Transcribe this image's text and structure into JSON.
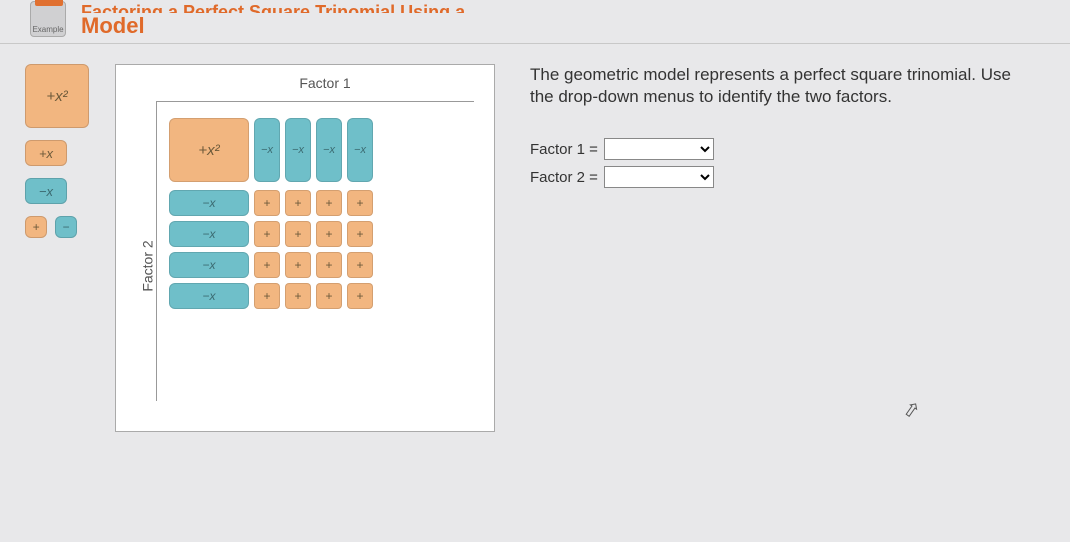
{
  "header": {
    "badge_label": "Example",
    "title_top": "Factoring a Perfect Square Trinomial Using a",
    "title_bottom": "Model"
  },
  "palette": {
    "x2": "+x²",
    "plus_x": "+x",
    "minus_x": "−x",
    "plus_unit": "+",
    "minus_unit": "−"
  },
  "board": {
    "factor1_label": "Factor 1",
    "factor2_label": "Factor 2",
    "big_x2": "+x²",
    "col_tiles": [
      "−x",
      "−x",
      "−x",
      "−x"
    ],
    "rows": [
      {
        "side": "−x",
        "units": [
          "+",
          "+",
          "+",
          "+"
        ]
      },
      {
        "side": "−x",
        "units": [
          "+",
          "+",
          "+",
          "+"
        ]
      },
      {
        "side": "−x",
        "units": [
          "+",
          "+",
          "+",
          "+"
        ]
      },
      {
        "side": "−x",
        "units": [
          "+",
          "+",
          "+",
          "+"
        ]
      }
    ]
  },
  "right": {
    "instructions": "The geometric model represents a perfect square trinomial. Use the drop-down menus to identify the two factors.",
    "factor1_label": "Factor 1 =",
    "factor2_label": "Factor 2 =",
    "dropdown_placeholder": ""
  }
}
